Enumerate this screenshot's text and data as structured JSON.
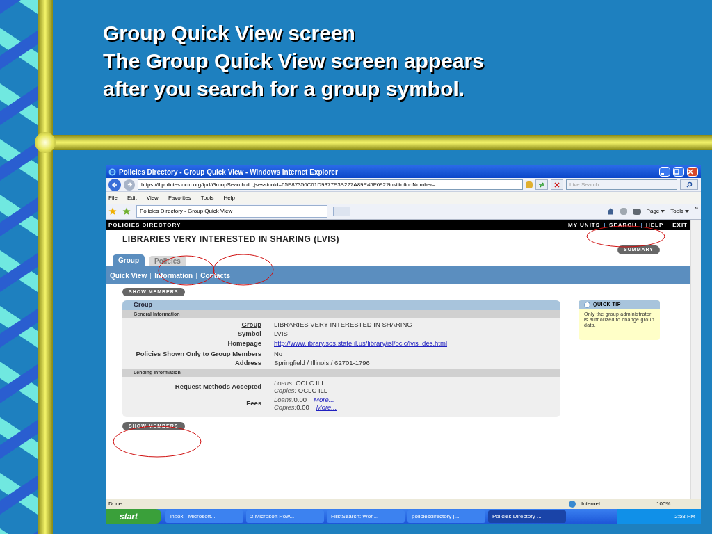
{
  "slide": {
    "title_lines": [
      "Group Quick View screen",
      "The Group Quick View screen appears",
      "after you search for a group symbol."
    ]
  },
  "browser": {
    "title": "Policies Directory - Group Quick View - Windows Internet Explorer",
    "address": "https://illpolicies.oclc.org/ipd/GroupSearch.do;jsessionid=65E87356C61D9377E3B227A89E45F692?institutionNumber=",
    "search": {
      "placeholder": "Live Search"
    },
    "menu": [
      "File",
      "Edit",
      "View",
      "Favorites",
      "Tools",
      "Help"
    ],
    "tab": "Policies Directory - Group Quick View",
    "tools": [
      "Page",
      "Tools"
    ],
    "chevron": "»"
  },
  "page": {
    "brand": "POLICIES DIRECTORY",
    "nav": [
      "MY UNITS",
      "SEARCH",
      "HELP",
      "EXIT"
    ],
    "heading": "LIBRARIES VERY INTERESTED IN SHARING (LVIS)",
    "summary_button": "SUMMARY",
    "tabs": [
      {
        "label": "Group",
        "selected": true
      },
      {
        "label": "Policies",
        "selected": false
      }
    ],
    "subnav": [
      "Quick View",
      "Information",
      "Contacts"
    ],
    "show_members_top": "SHOW MEMBERS",
    "panel": {
      "title": "Group",
      "sections": [
        {
          "title": "General Information",
          "rows": [
            {
              "label": "Group",
              "link": true,
              "values": [
                {
                  "text": "LIBRARIES VERY INTERESTED IN SHARING"
                }
              ]
            },
            {
              "label": "Symbol",
              "link": true,
              "values": [
                {
                  "text": "LVIS"
                }
              ]
            },
            {
              "label": "Homepage",
              "link": false,
              "values": [
                {
                  "url": "http://www.library.sos.state.il.us/library/isl/oclc/lvis_des.html"
                }
              ]
            },
            {
              "label": "Policies Shown Only to Group Members",
              "link": false,
              "values": [
                {
                  "text": "No"
                }
              ]
            },
            {
              "label": "Address",
              "link": false,
              "values": [
                {
                  "text": "Springfield / Illinois / 62701-1796"
                }
              ]
            }
          ]
        },
        {
          "title": "Lending Information",
          "rows": [
            {
              "label": "Request Methods Accepted",
              "link": false,
              "values": [
                {
                  "prefix": "Loans:",
                  "text": " OCLC ILL"
                },
                {
                  "prefix": "Copies:",
                  "text": " OCLC ILL"
                }
              ]
            },
            {
              "label": "Fees",
              "link": false,
              "values": [
                {
                  "prefix": "Loans:",
                  "text": "0.00",
                  "more": "More..."
                },
                {
                  "prefix": "Copies:",
                  "text": "0.00",
                  "more": "More..."
                }
              ]
            }
          ]
        }
      ]
    },
    "quick_tip": {
      "title": "QUICK TIP",
      "text": "Only the group administrator is authorized to change group data."
    },
    "show_members_bottom": "SHOW MEMBERS"
  },
  "status_bar": {
    "text": "Done",
    "zone": "Internet",
    "zoom": "100%"
  },
  "taskbar": {
    "start": "start",
    "tasks": [
      {
        "label": "Inbox - Microsoft...",
        "selected": false
      },
      {
        "label": "2 Microsoft Pow...",
        "selected": false
      },
      {
        "label": "FirstSearch: Worl...",
        "selected": false
      },
      {
        "label": "policiesdirectory [...",
        "selected": false
      },
      {
        "label": "Policies Directory ...",
        "selected": true
      }
    ],
    "time": "2:58 PM"
  }
}
